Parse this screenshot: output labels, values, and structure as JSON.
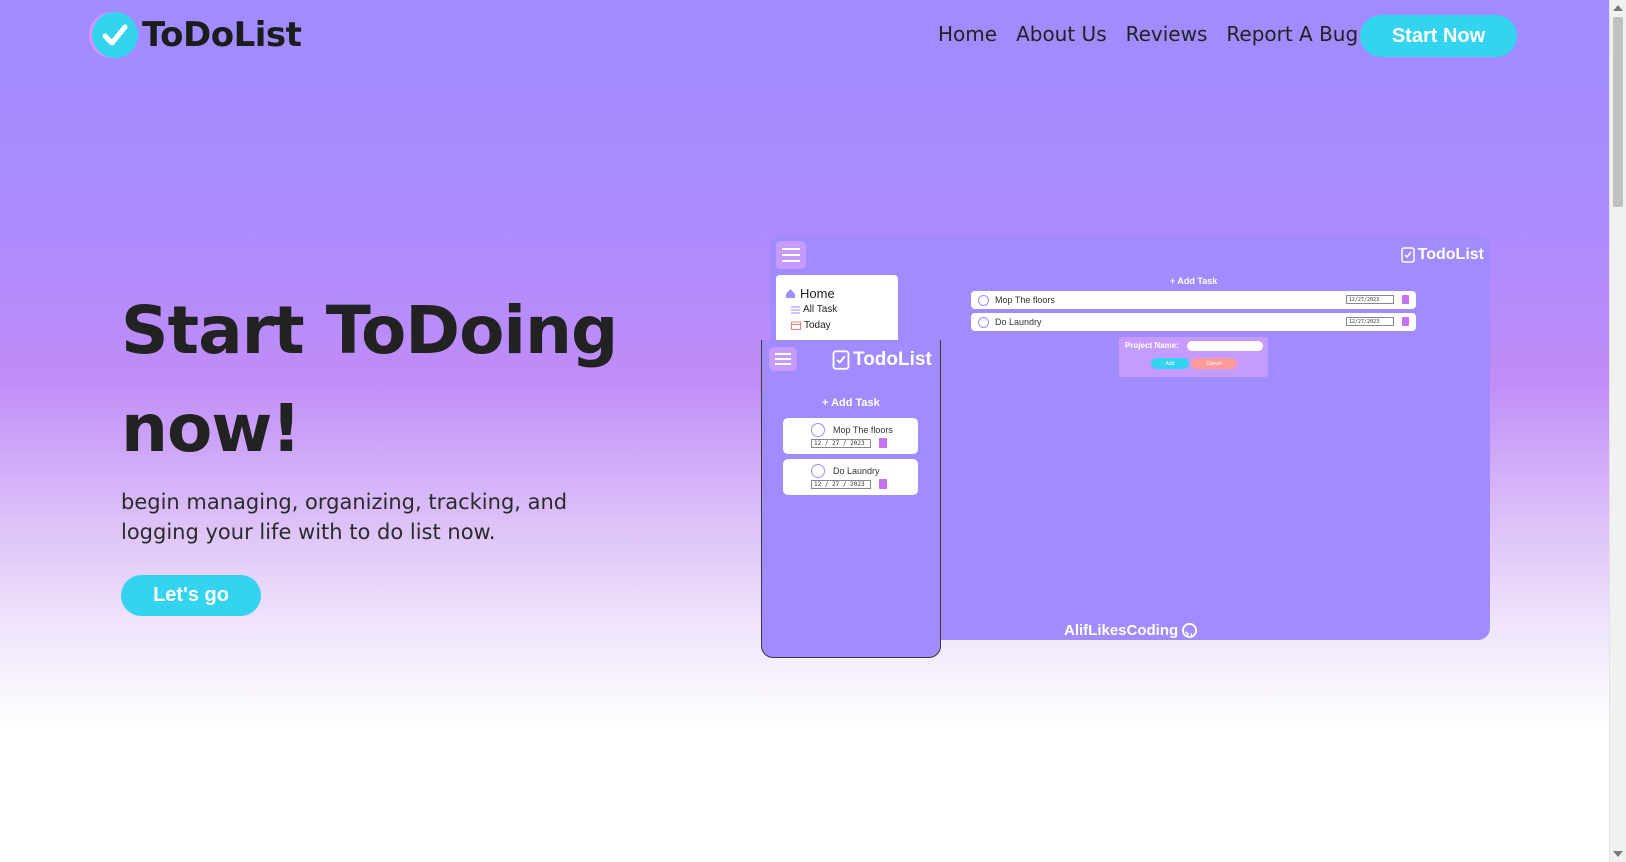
{
  "brand": {
    "name": "ToDoList"
  },
  "nav": {
    "links": [
      "Home",
      "About Us",
      "Reviews",
      "Report A Bug"
    ],
    "cta": "Start Now"
  },
  "hero": {
    "title": "Start ToDoing now!",
    "subtitle": "begin managing, organizing, tracking, and logging your life with to do list now.",
    "button": "Let's go"
  },
  "desktop_preview": {
    "brand": "TodoList",
    "sidebar": [
      "Home",
      "All Task",
      "Today"
    ],
    "add_task": "+ Add Task",
    "tasks": [
      {
        "name": "Mop The floors",
        "date": "12/27/2023"
      },
      {
        "name": "Do Laundry",
        "date": "12/27/2023"
      }
    ],
    "project_label": "Project Name:",
    "add_button": "Add",
    "cancel_button": "Cancel",
    "credit": "AlifLikesCoding"
  },
  "mobile_preview": {
    "brand": "TodoList",
    "add_task": "+ Add Task",
    "tasks": [
      {
        "name": "Mop The floors",
        "date": "12 / 27 / 2023"
      },
      {
        "name": "Do Laundry",
        "date": "12 / 27 / 2023"
      }
    ]
  },
  "colors": {
    "accent": "#34d3f0",
    "purple": "#a18bff",
    "light_purple": "#c69bff",
    "trash": "#c770f0"
  }
}
